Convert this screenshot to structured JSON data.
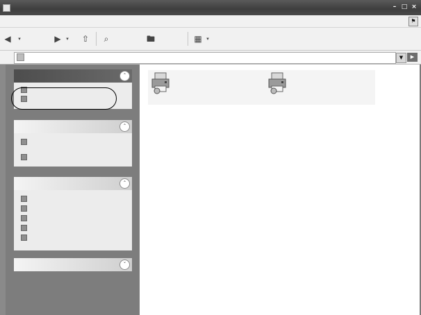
{
  "window": {
    "title": "       ",
    "controls": [
      "–",
      "□",
      "×"
    ]
  },
  "menubar": {
    "items": [
      " ",
      " ",
      " ",
      " ",
      " ",
      " "
    ]
  },
  "toolbar": {
    "back_label": "",
    "forward_label": "",
    "search_label": "",
    "folders_label": ""
  },
  "address": {
    "label": "",
    "path": ""
  },
  "task_panes": [
    {
      "title": "",
      "items": [
        {
          "label": "",
          "icon": "printer-icon"
        },
        {
          "label": "",
          "icon": "wrench-icon"
        }
      ]
    },
    {
      "title": "",
      "items": [
        {
          "label": "",
          "icon": "folder-icon"
        },
        {
          "label": "",
          "icon": "share-icon"
        }
      ]
    },
    {
      "title": "",
      "items": [
        {
          "label": "",
          "icon": "control-panel-icon"
        },
        {
          "label": "",
          "icon": "scanner-icon"
        },
        {
          "label": "",
          "icon": "documents-icon"
        },
        {
          "label": "",
          "icon": "pictures-icon"
        },
        {
          "label": "",
          "icon": "computer-icon"
        }
      ]
    },
    {
      "title": "",
      "items": []
    }
  ],
  "content": {
    "items": [
      {
        "name": "",
        "subtitle": "",
        "icon": "printer-icon"
      },
      {
        "name": "",
        "subtitle": "",
        "icon": "printer-icon"
      }
    ]
  },
  "colors": {
    "titlebar": "#4a4a4a",
    "taskpane": "#7d7d7d",
    "panel_body": "#ececec"
  }
}
